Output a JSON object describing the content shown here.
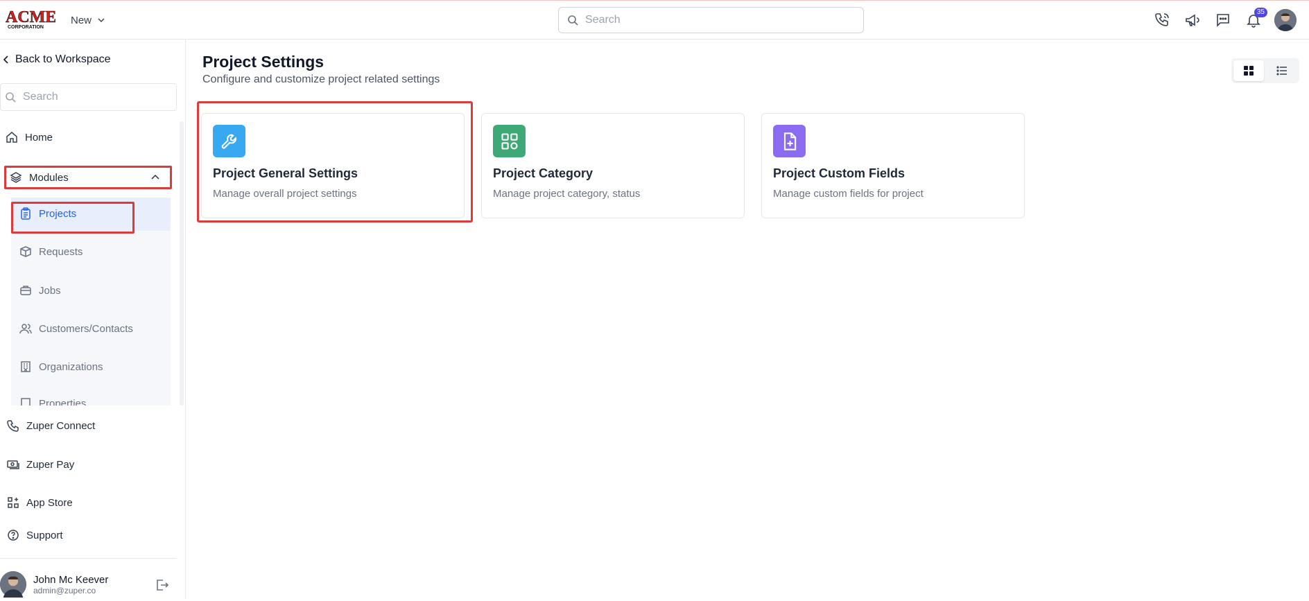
{
  "brand": {
    "logo_text": "ACME",
    "logo_sub": "CORPORATION"
  },
  "header": {
    "new_label": "New",
    "search_placeholder": "Search",
    "notification_count": "35"
  },
  "sidebar": {
    "back_label": "Back to Workspace",
    "search_placeholder": "Search",
    "home_label": "Home",
    "modules_label": "Modules",
    "sub_items": [
      {
        "label": "Projects"
      },
      {
        "label": "Requests"
      },
      {
        "label": "Jobs"
      },
      {
        "label": "Customers/Contacts"
      },
      {
        "label": "Organizations"
      },
      {
        "label": "Properties"
      }
    ],
    "bottom_items": [
      {
        "label": "Zuper Connect"
      },
      {
        "label": "Zuper Pay"
      },
      {
        "label": "App Store"
      },
      {
        "label": "Support"
      }
    ],
    "user": {
      "name": "John Mc Keever",
      "email": "admin@zuper.co"
    }
  },
  "main": {
    "title": "Project Settings",
    "subtitle": "Configure and customize project related settings",
    "cards": [
      {
        "title": "Project General Settings",
        "desc": "Manage overall project settings",
        "icon": "wrench-icon",
        "color": "#38a9f0"
      },
      {
        "title": "Project Category",
        "desc": "Manage project category, status",
        "icon": "grid-icon",
        "color": "#3fa877"
      },
      {
        "title": "Project Custom Fields",
        "desc": "Manage custom fields for project",
        "icon": "file-plus-icon",
        "color": "#8b6cf0"
      }
    ]
  },
  "colors": {
    "highlight": "#dc3b3b",
    "active_text": "#2563eb",
    "badge": "#4f46e5"
  }
}
